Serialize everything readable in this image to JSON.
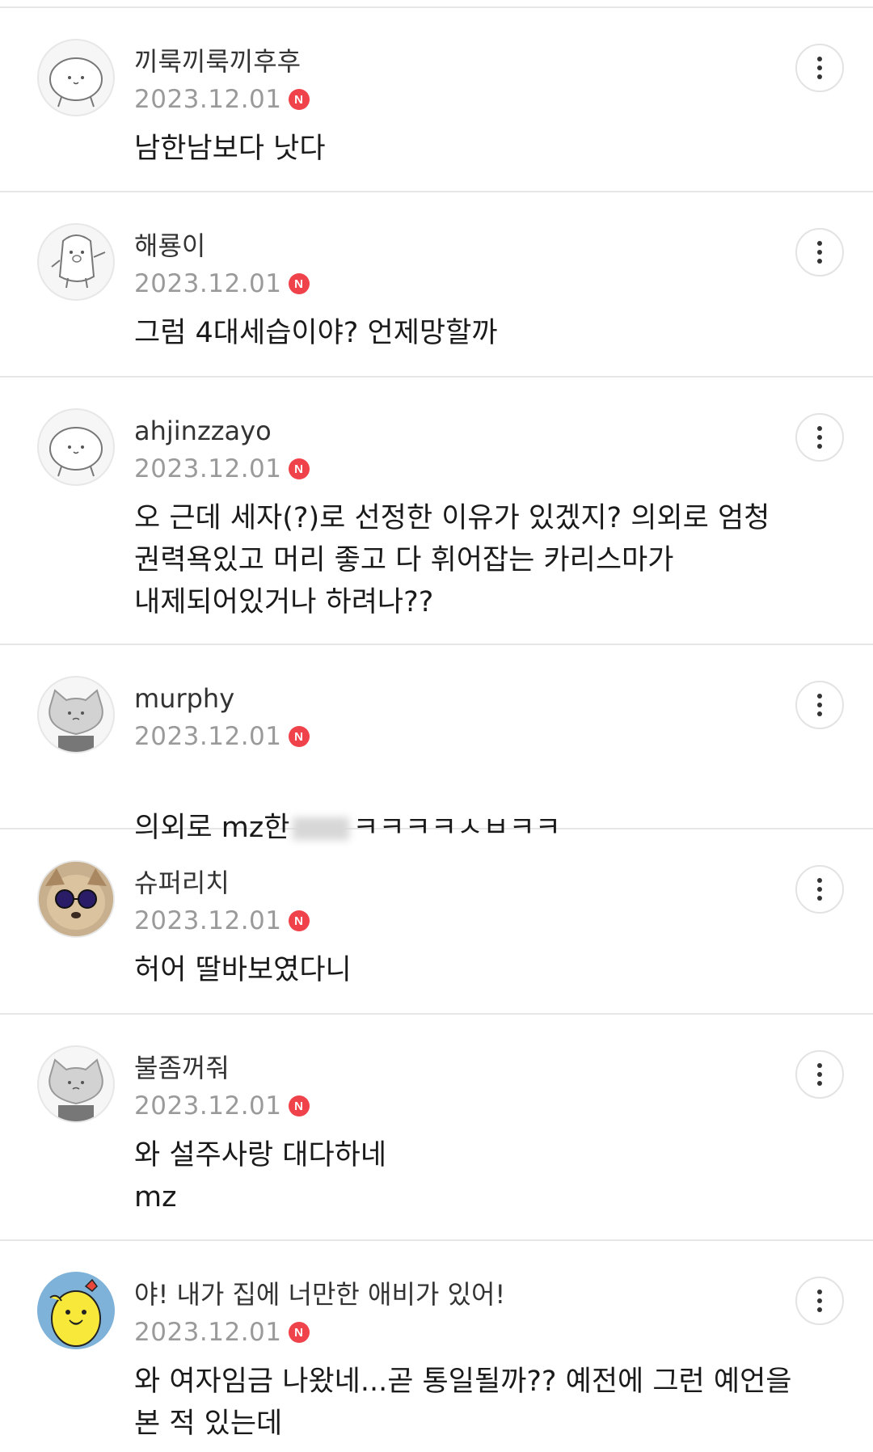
{
  "comments": [
    {
      "nickname": "끼룩끼룩끼후후",
      "date": "2023.12.01",
      "badge": "N",
      "avatar_icon": "default-face-icon",
      "text": "남한남보다 낫다"
    },
    {
      "nickname": "해룡이",
      "date": "2023.12.01",
      "badge": "N",
      "avatar_icon": "waving-character-icon",
      "text": "그럼 4대세습이야? 언제망할까"
    },
    {
      "nickname": "ahjinzzayo",
      "date": "2023.12.01",
      "badge": "N",
      "avatar_icon": "default-face-icon",
      "text": "오 근데 세자(?)로 선정한 이유가 있겠지? 의외로 엄청\n권력욕있고 머리 좋고 다 휘어잡는 카리스마가\n내제되어있거나 하려나??"
    },
    {
      "nickname": "murphy",
      "date": "2023.12.01",
      "badge": "N",
      "avatar_icon": "grey-cat-icon",
      "text_before": "의외로 mz한",
      "text_after": "ㅋㅋㅋㅋㅅㅂㅋㅋ"
    },
    {
      "nickname": "슈퍼리치",
      "date": "2023.12.01",
      "badge": "N",
      "avatar_icon": "dog-sunglasses-icon",
      "text": "허어 딸바보였다니"
    },
    {
      "nickname": "불좀꺼줘",
      "date": "2023.12.01",
      "badge": "N",
      "avatar_icon": "grey-cat-icon",
      "text": "와 설주사랑 대다하네\nmz"
    },
    {
      "nickname": "야! 내가 집에 너만한 애비가 있어!",
      "date": "2023.12.01",
      "badge": "N",
      "avatar_icon": "yellow-chick-icon",
      "text": "와 여자임금 나왔네...곧 통일될까?? 예전에 그런 예언을\n본 적 있는데"
    }
  ],
  "colors": {
    "badge": "#f0424a",
    "date": "#9a9a9a",
    "divider": "#e6e6e6"
  }
}
